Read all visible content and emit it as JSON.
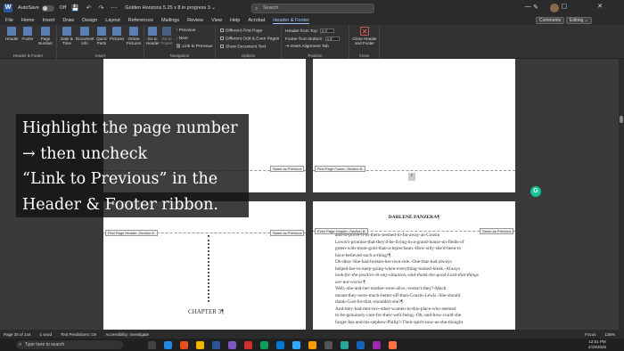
{
  "titlebar": {
    "app_glyph": "W",
    "autosave_label": "AutoSave",
    "autosave_state": "Off",
    "quick_access": "💾 ↶ ↷ ⋯",
    "document_title": "Golden Horizons 5.25 x 8 in progress 3 ⌄",
    "search_placeholder": "Search",
    "window_controls": "— ▢ ✕"
  },
  "menu": {
    "tabs": [
      "File",
      "Home",
      "Insert",
      "Draw",
      "Design",
      "Layout",
      "References",
      "Mailings",
      "Review",
      "View",
      "Help",
      "Acrobat",
      "Header & Footer"
    ],
    "active_tab": "Header & Footer",
    "comments_label": "Comments",
    "editing_label": "Editing ⌄"
  },
  "ribbon": {
    "groups": {
      "header_footer": {
        "label": "Header & Footer",
        "buttons": [
          "Header",
          "Footer",
          "Page Number"
        ]
      },
      "insert": {
        "label": "Insert",
        "buttons": [
          "Date & Time",
          "Document Info",
          "Quick Parts",
          "Pictures",
          "Online Pictures"
        ]
      },
      "navigation": {
        "label": "Navigation",
        "buttons": [
          "Go to Header",
          "Go to Footer"
        ],
        "items": [
          "Previous",
          "Next",
          "Link to Previous"
        ]
      },
      "options": {
        "label": "Options",
        "items": [
          "Different First Page",
          "Different Odd & Even Pages",
          "Show Document Text"
        ]
      },
      "position": {
        "label": "Position",
        "header_from_top": "Header from Top:",
        "header_value": "0.4\"",
        "footer_from_bottom": "Footer from Bottom:",
        "footer_value": "0.5\"",
        "insert_alignment": "Insert Alignment Tab"
      },
      "close": {
        "label": "Close",
        "button": "Close Header and Footer"
      }
    }
  },
  "pages": {
    "tags": {
      "same_as_previous": "Same as Previous",
      "first_page_footer": "First Page Footer -Section 8-",
      "first_page_header": "First Page Header -Section 8-",
      "even_page_header": "Even Page Header -Section 8-"
    },
    "author_header": "DARLENE PANZERA¶",
    "chapter_heading": "CHAPTER 3¶",
    "body_lines": [
      "and-to-prove-it-to-them-seemed-to-far-away-as-Cousin",
      "Lewis's-promise-that-they'd-be-living-in-a-grand-house-on-fields-of",
      "green-with-more-gold-than-a-leprechaun.-How-silly-she'd-been-to",
      "have-believed-such-a-thing!¶",
      "Oh-dear.-She-had-broken-her-own-rule.-One-that-had-always",
      "helped-her-to-keep-going-when-everything-looked-bleak.-Always",
      "look-for-the-positive-in-any-situation,-and-thank-the-good-Lord-that-things",
      "are-not-worse.¶",
      "Well,-she-and-her-mother-were-alive,-weren't-they?-Much",
      "meant-they-were-much-better-off-than-Cousin-Lewis.-She-should",
      "thank-God-for-that,-shouldn't-she?¶",
      "And-they-had-met-two-other-women-in-this-place-who-seemed",
      "to-be-genuinely-care-for-their-well-being.-Oh,-and-how-could-she",
      "forget-Ian-and-his-nephew-Philip?-Their-spirit-now-as-she-thought"
    ]
  },
  "overlay": {
    "lines": [
      "Highlight the page number",
      "→ then uncheck",
      "“Link to Previous” in the",
      "Header & Footer ribbon."
    ]
  },
  "status": {
    "page": "Page 30 of 144",
    "words": "1 word",
    "text_predictions": "Text Predictions: On",
    "accessibility": "Accessibility: Investigate",
    "focus": "Focus",
    "zoom": "136%"
  },
  "taskbar": {
    "search_placeholder": "Type here to search",
    "time": "12:51 PM",
    "date": "2/19/2025"
  },
  "colors": {
    "accent": "#9ec5ff",
    "grammarly": "#15c39a",
    "ribbon_bg": "#323232"
  }
}
